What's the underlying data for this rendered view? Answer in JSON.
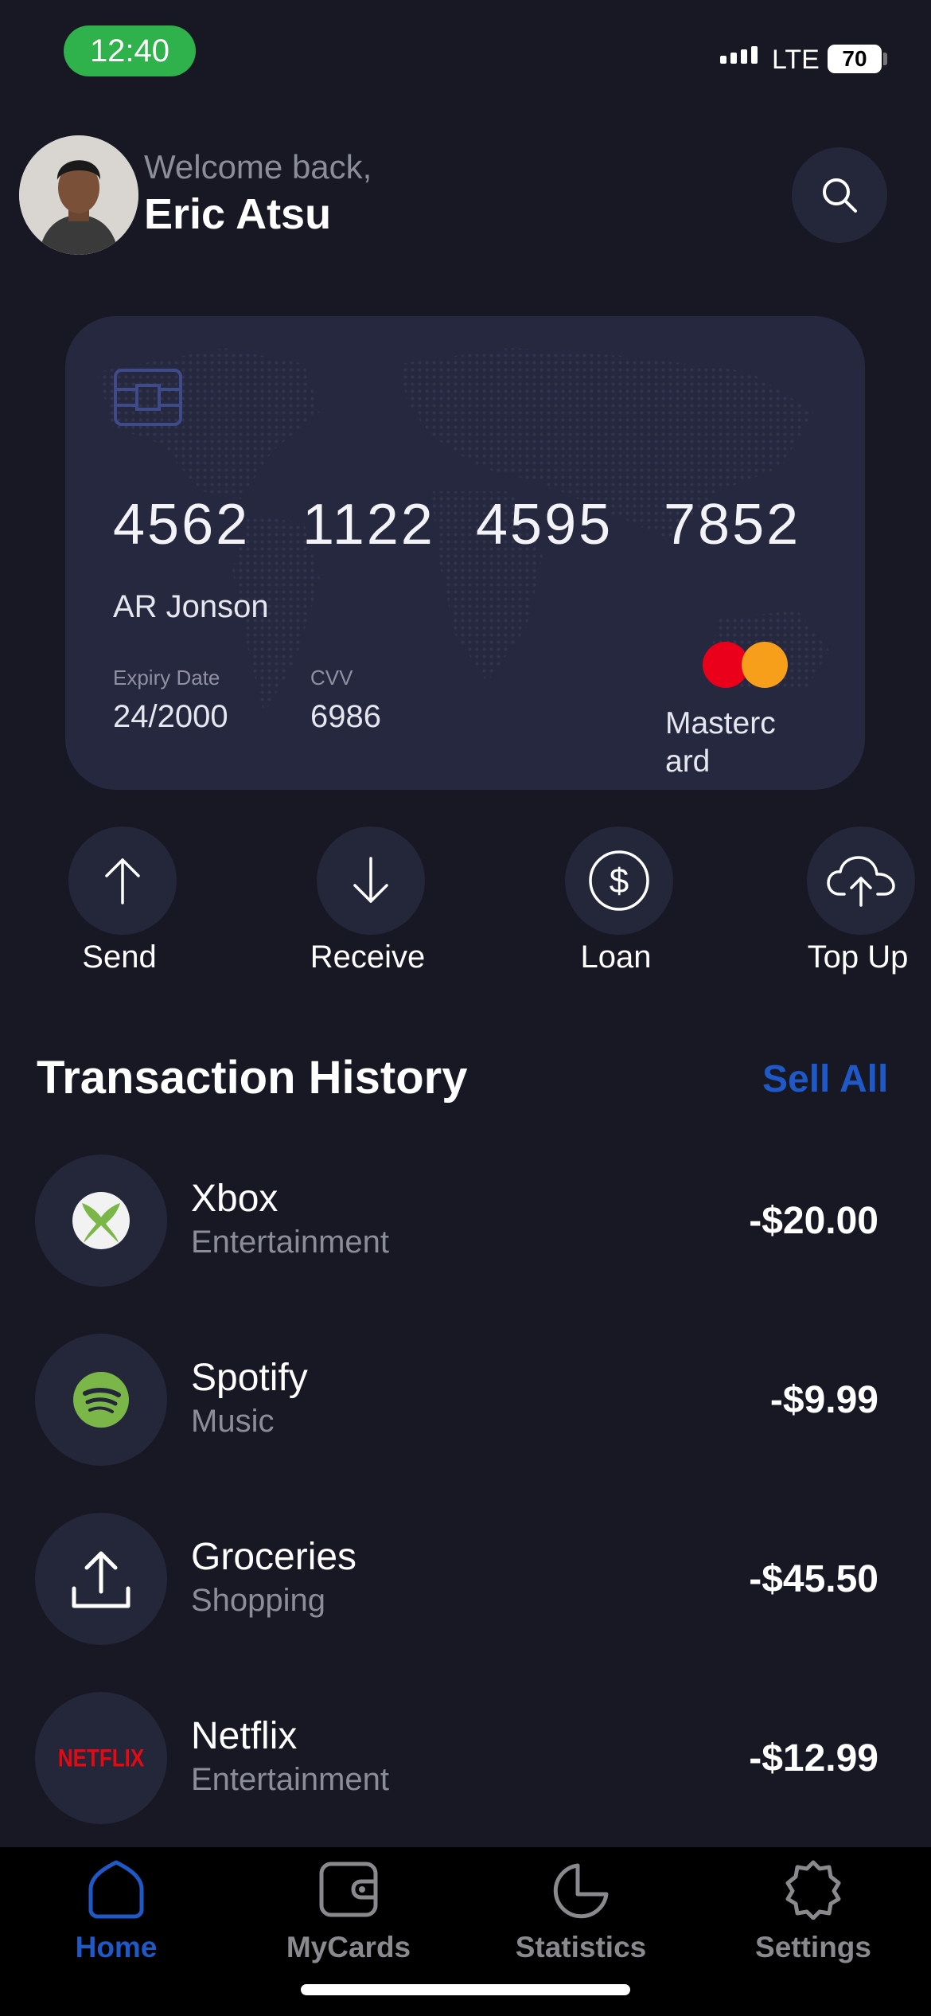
{
  "status_bar": {
    "time": "12:40",
    "network": "LTE",
    "battery": "70"
  },
  "header": {
    "welcome": "Welcome back,",
    "user_name": "Eric Atsu"
  },
  "card": {
    "number_groups": [
      "4562",
      "1122",
      "4595",
      "7852"
    ],
    "holder": "AR Jonson",
    "expiry_label": "Expiry Date",
    "expiry_value": "24/2000",
    "cvv_label": "CVV",
    "cvv_value": "6986",
    "brand": "Mastercard"
  },
  "quick_actions": [
    {
      "label": "Send",
      "icon": "arrow-up-icon"
    },
    {
      "label": "Receive",
      "icon": "arrow-down-icon"
    },
    {
      "label": "Loan",
      "icon": "dollar-circle-icon"
    },
    {
      "label": "Top Up",
      "icon": "cloud-upload-icon"
    }
  ],
  "transactions": {
    "title": "Transaction History",
    "see_all": "Sell All",
    "items": [
      {
        "name": "Xbox",
        "category": "Entertainment",
        "amount": "-$20.00",
        "icon": "xbox-icon"
      },
      {
        "name": "Spotify",
        "category": "Music",
        "amount": "-$9.99",
        "icon": "spotify-icon"
      },
      {
        "name": "Groceries",
        "category": "Shopping",
        "amount": "-$45.50",
        "icon": "upload-icon"
      },
      {
        "name": "Netflix",
        "category": "Entertainment",
        "amount": "-$12.99",
        "icon": "netflix-icon",
        "logo_text": "NETFLIX"
      }
    ]
  },
  "nav": {
    "items": [
      {
        "label": "Home",
        "icon": "home-icon",
        "active": true
      },
      {
        "label": "MyCards",
        "icon": "wallet-icon",
        "active": false
      },
      {
        "label": "Statistics",
        "icon": "pie-chart-icon",
        "active": false
      },
      {
        "label": "Settings",
        "icon": "gear-icon",
        "active": false
      }
    ]
  },
  "colors": {
    "background": "#171824",
    "accent": "#1f58c7",
    "status_pill": "#2fb24c",
    "card": "#26283f"
  }
}
